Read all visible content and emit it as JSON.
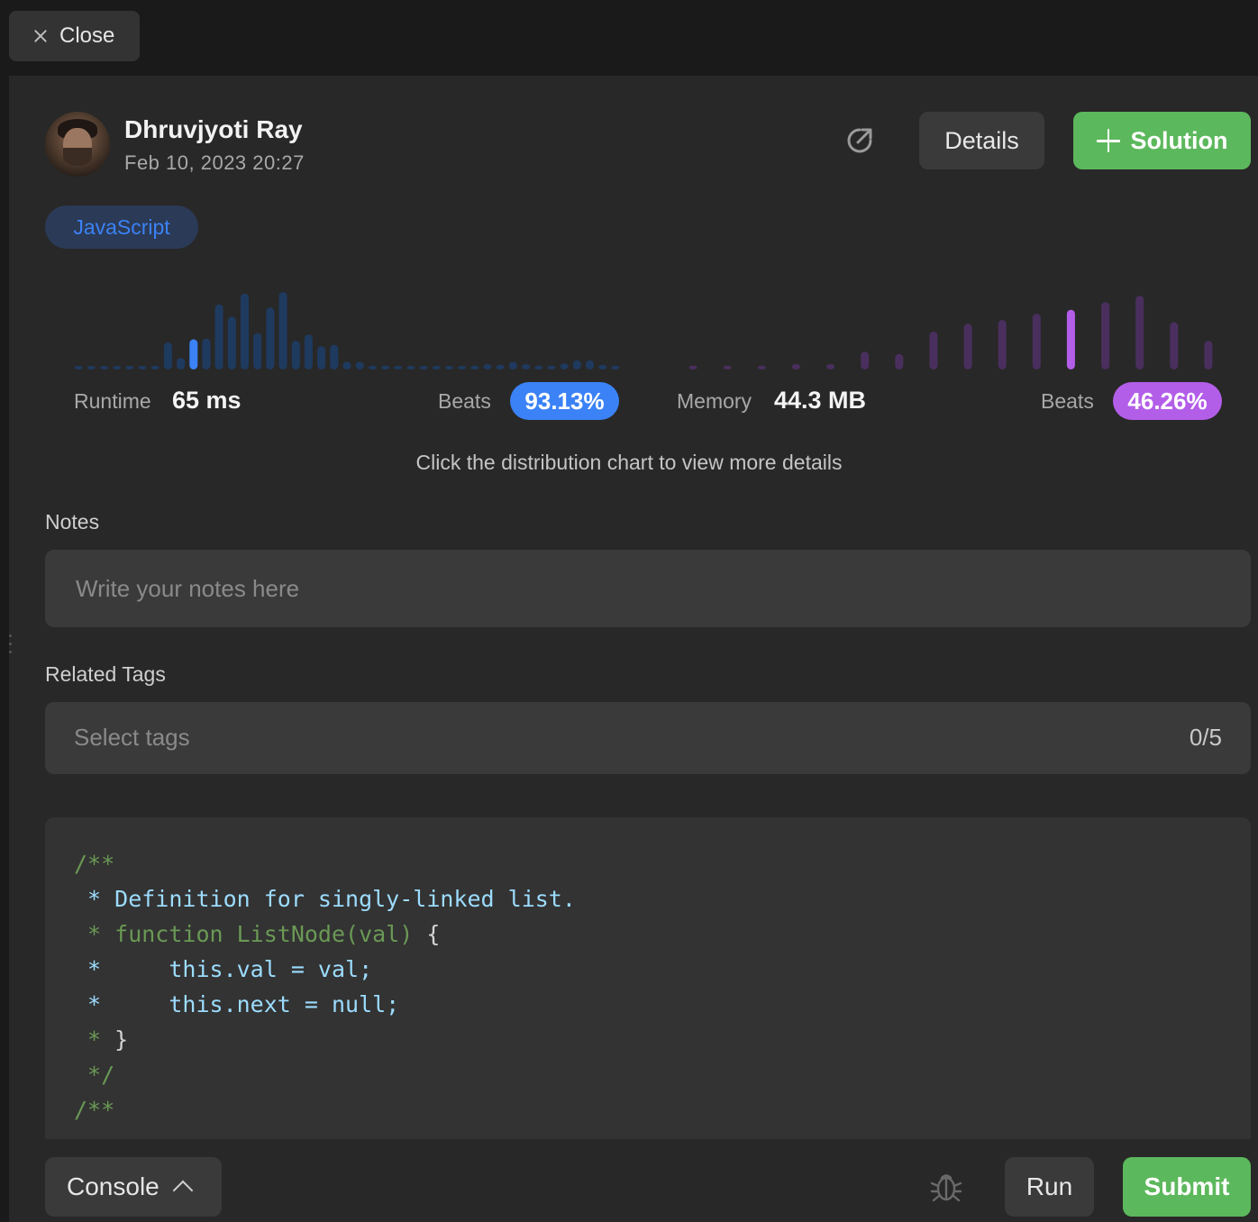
{
  "topbar": {
    "close_label": "Close"
  },
  "user": {
    "name": "Dhruvjyoti Ray",
    "date": "Feb 10, 2023 20:27"
  },
  "actions": {
    "details_label": "Details",
    "solution_label": "Solution"
  },
  "language": "JavaScript",
  "runtime": {
    "label": "Runtime",
    "value": "65 ms",
    "beats_label": "Beats",
    "beats": "93.13%",
    "color": "#3b82f6",
    "dim_color": "#1f3a5f",
    "distribution": [
      0.03,
      0.03,
      0.03,
      0.03,
      0.04,
      0.04,
      0.05,
      0.35,
      0.15,
      0.39,
      0.4,
      0.84,
      0.68,
      0.98,
      0.47,
      0.8,
      1.0,
      0.37,
      0.45,
      0.3,
      0.32,
      0.1,
      0.1,
      0.05,
      0.05,
      0.04,
      0.04,
      0.03,
      0.03,
      0.04,
      0.04,
      0.05,
      0.07,
      0.06,
      0.1,
      0.07,
      0.05,
      0.05,
      0.08,
      0.12,
      0.12,
      0.06,
      0.05
    ],
    "highlight_index": 9
  },
  "memory": {
    "label": "Memory",
    "value": "44.3 MB",
    "beats_label": "Beats",
    "beats": "46.26%",
    "color": "#b35ee8",
    "dim_color": "#4a2f5e",
    "distribution": [
      0.05,
      0.05,
      0.05,
      0.07,
      0.07,
      0.23,
      0.2,
      0.49,
      0.59,
      0.64,
      0.72,
      0.77,
      0.87,
      0.95,
      0.61,
      0.37
    ],
    "highlight_index": 11
  },
  "hint": "Click the distribution chart to view more details",
  "notes": {
    "label": "Notes",
    "placeholder": "Write your notes here"
  },
  "tags": {
    "label": "Related Tags",
    "placeholder": "Select tags",
    "count": "0/5"
  },
  "code_lines": [
    [
      {
        "t": "/**",
        "c": "c-green"
      }
    ],
    [
      {
        "t": " * ",
        "c": "c-blue"
      },
      {
        "t": "Definition for singly-linked list.",
        "c": "c-blue"
      }
    ],
    [
      {
        "t": " * ",
        "c": "c-green"
      },
      {
        "t": "function ListNode(val) ",
        "c": "c-green"
      },
      {
        "t": "{",
        "c": "c-white"
      }
    ],
    [
      {
        "t": " *     ",
        "c": "c-blue"
      },
      {
        "t": "this.val = val;",
        "c": "c-blue"
      }
    ],
    [
      {
        "t": " *     ",
        "c": "c-blue"
      },
      {
        "t": "this.next = null;",
        "c": "c-blue"
      }
    ],
    [
      {
        "t": " * ",
        "c": "c-green"
      },
      {
        "t": "}",
        "c": "c-white"
      }
    ],
    [
      {
        "t": " */",
        "c": "c-green"
      }
    ],
    [
      {
        "t": "/**",
        "c": "c-green"
      }
    ]
  ],
  "bottom": {
    "console_label": "Console",
    "run_label": "Run",
    "submit_label": "Submit"
  }
}
